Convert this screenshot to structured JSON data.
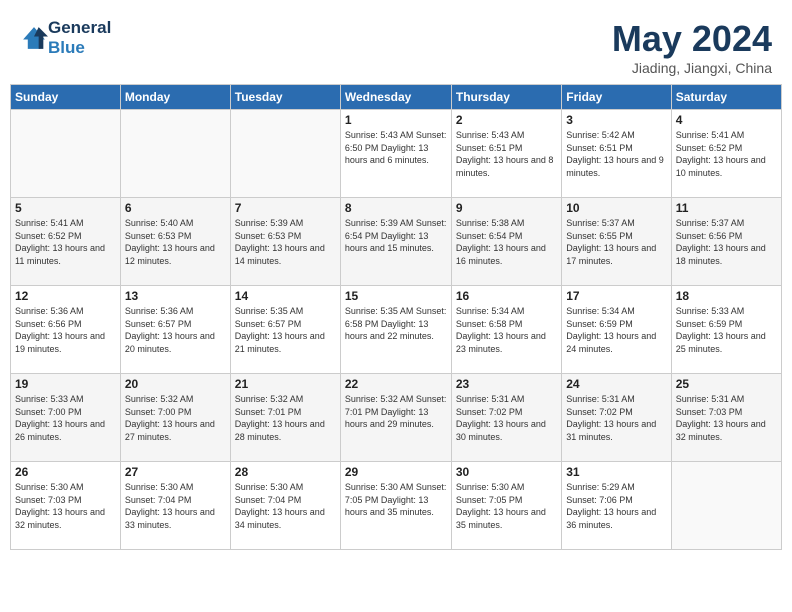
{
  "header": {
    "logo_line1": "General",
    "logo_line2": "Blue",
    "month_title": "May 2024",
    "location": "Jiading, Jiangxi, China"
  },
  "days_of_week": [
    "Sunday",
    "Monday",
    "Tuesday",
    "Wednesday",
    "Thursday",
    "Friday",
    "Saturday"
  ],
  "weeks": [
    [
      {
        "day": "",
        "info": ""
      },
      {
        "day": "",
        "info": ""
      },
      {
        "day": "",
        "info": ""
      },
      {
        "day": "1",
        "info": "Sunrise: 5:43 AM\nSunset: 6:50 PM\nDaylight: 13 hours and 6 minutes."
      },
      {
        "day": "2",
        "info": "Sunrise: 5:43 AM\nSunset: 6:51 PM\nDaylight: 13 hours and 8 minutes."
      },
      {
        "day": "3",
        "info": "Sunrise: 5:42 AM\nSunset: 6:51 PM\nDaylight: 13 hours and 9 minutes."
      },
      {
        "day": "4",
        "info": "Sunrise: 5:41 AM\nSunset: 6:52 PM\nDaylight: 13 hours and 10 minutes."
      }
    ],
    [
      {
        "day": "5",
        "info": "Sunrise: 5:41 AM\nSunset: 6:52 PM\nDaylight: 13 hours and 11 minutes."
      },
      {
        "day": "6",
        "info": "Sunrise: 5:40 AM\nSunset: 6:53 PM\nDaylight: 13 hours and 12 minutes."
      },
      {
        "day": "7",
        "info": "Sunrise: 5:39 AM\nSunset: 6:53 PM\nDaylight: 13 hours and 14 minutes."
      },
      {
        "day": "8",
        "info": "Sunrise: 5:39 AM\nSunset: 6:54 PM\nDaylight: 13 hours and 15 minutes."
      },
      {
        "day": "9",
        "info": "Sunrise: 5:38 AM\nSunset: 6:54 PM\nDaylight: 13 hours and 16 minutes."
      },
      {
        "day": "10",
        "info": "Sunrise: 5:37 AM\nSunset: 6:55 PM\nDaylight: 13 hours and 17 minutes."
      },
      {
        "day": "11",
        "info": "Sunrise: 5:37 AM\nSunset: 6:56 PM\nDaylight: 13 hours and 18 minutes."
      }
    ],
    [
      {
        "day": "12",
        "info": "Sunrise: 5:36 AM\nSunset: 6:56 PM\nDaylight: 13 hours and 19 minutes."
      },
      {
        "day": "13",
        "info": "Sunrise: 5:36 AM\nSunset: 6:57 PM\nDaylight: 13 hours and 20 minutes."
      },
      {
        "day": "14",
        "info": "Sunrise: 5:35 AM\nSunset: 6:57 PM\nDaylight: 13 hours and 21 minutes."
      },
      {
        "day": "15",
        "info": "Sunrise: 5:35 AM\nSunset: 6:58 PM\nDaylight: 13 hours and 22 minutes."
      },
      {
        "day": "16",
        "info": "Sunrise: 5:34 AM\nSunset: 6:58 PM\nDaylight: 13 hours and 23 minutes."
      },
      {
        "day": "17",
        "info": "Sunrise: 5:34 AM\nSunset: 6:59 PM\nDaylight: 13 hours and 24 minutes."
      },
      {
        "day": "18",
        "info": "Sunrise: 5:33 AM\nSunset: 6:59 PM\nDaylight: 13 hours and 25 minutes."
      }
    ],
    [
      {
        "day": "19",
        "info": "Sunrise: 5:33 AM\nSunset: 7:00 PM\nDaylight: 13 hours and 26 minutes."
      },
      {
        "day": "20",
        "info": "Sunrise: 5:32 AM\nSunset: 7:00 PM\nDaylight: 13 hours and 27 minutes."
      },
      {
        "day": "21",
        "info": "Sunrise: 5:32 AM\nSunset: 7:01 PM\nDaylight: 13 hours and 28 minutes."
      },
      {
        "day": "22",
        "info": "Sunrise: 5:32 AM\nSunset: 7:01 PM\nDaylight: 13 hours and 29 minutes."
      },
      {
        "day": "23",
        "info": "Sunrise: 5:31 AM\nSunset: 7:02 PM\nDaylight: 13 hours and 30 minutes."
      },
      {
        "day": "24",
        "info": "Sunrise: 5:31 AM\nSunset: 7:02 PM\nDaylight: 13 hours and 31 minutes."
      },
      {
        "day": "25",
        "info": "Sunrise: 5:31 AM\nSunset: 7:03 PM\nDaylight: 13 hours and 32 minutes."
      }
    ],
    [
      {
        "day": "26",
        "info": "Sunrise: 5:30 AM\nSunset: 7:03 PM\nDaylight: 13 hours and 32 minutes."
      },
      {
        "day": "27",
        "info": "Sunrise: 5:30 AM\nSunset: 7:04 PM\nDaylight: 13 hours and 33 minutes."
      },
      {
        "day": "28",
        "info": "Sunrise: 5:30 AM\nSunset: 7:04 PM\nDaylight: 13 hours and 34 minutes."
      },
      {
        "day": "29",
        "info": "Sunrise: 5:30 AM\nSunset: 7:05 PM\nDaylight: 13 hours and 35 minutes."
      },
      {
        "day": "30",
        "info": "Sunrise: 5:30 AM\nSunset: 7:05 PM\nDaylight: 13 hours and 35 minutes."
      },
      {
        "day": "31",
        "info": "Sunrise: 5:29 AM\nSunset: 7:06 PM\nDaylight: 13 hours and 36 minutes."
      },
      {
        "day": "",
        "info": ""
      }
    ]
  ]
}
